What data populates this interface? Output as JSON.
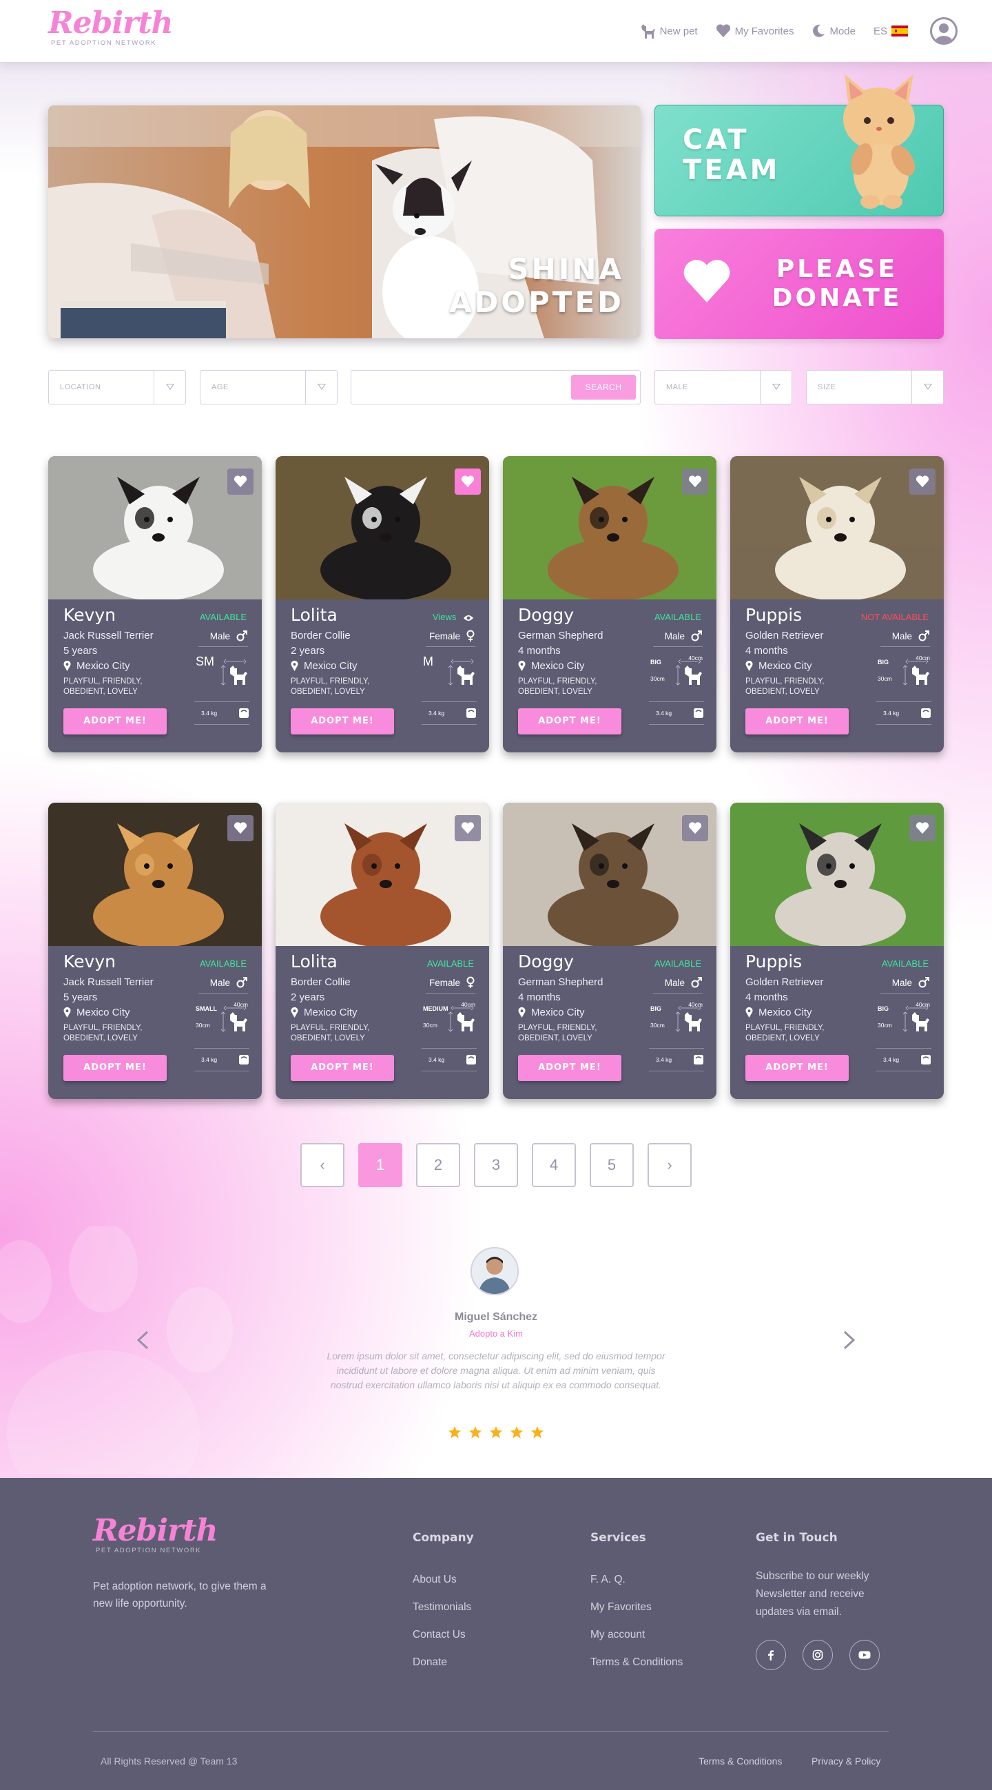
{
  "brand": {
    "name": "Rebirth",
    "tagline": "PET ADOPTION NETWORK",
    "accent": "#f683d5",
    "dark": "#5d5c73"
  },
  "nav": {
    "new_pet": "New pet",
    "favorites": "My Favorites",
    "mode": "Mode",
    "language": "ES"
  },
  "hero": {
    "caption_line1": "SHINA",
    "caption_line2": "ADOPTED"
  },
  "promos": {
    "cat_line1": "CAT",
    "cat_line2": "TEAM",
    "donate_line1": "PLEASE",
    "donate_line2": "DONATE"
  },
  "filters": {
    "location": "LOCATION",
    "age": "AGE",
    "search_placeholder": "",
    "search_button": "SEARCH",
    "sex": "MALE",
    "size": "SIZE"
  },
  "cards": [
    {
      "name": "Kevyn",
      "status": "AVAILABLE",
      "breed": "Jack Russell Terrier",
      "age": "5 years",
      "location": "Mexico City",
      "traits": "PLAYFUL, FRIENDLY, OBEDIENT, LOVELY",
      "gender": "Male",
      "size": "SM",
      "height": "",
      "weight": "3.4 kg",
      "adopt": "ADOPT ME!"
    },
    {
      "name": "Lolita",
      "status": "Views",
      "breed": "Border Collie",
      "age": "2 years",
      "location": "Mexico City",
      "traits": "PLAYFUL, FRIENDLY, OBEDIENT, LOVELY",
      "gender": "Female",
      "size": "M",
      "height": "",
      "weight": "3.4 kg",
      "adopt": "ADOPT ME!"
    },
    {
      "name": "Doggy",
      "status": "AVAILABLE",
      "breed": "German Shepherd",
      "age": "4 months",
      "location": "Mexico City",
      "traits": "PLAYFUL, FRIENDLY, OBEDIENT, LOVELY",
      "gender": "Male",
      "size": "BIG",
      "height": "30cm",
      "width": "40cm",
      "weight": "3.4 kg",
      "adopt": "ADOPT ME!"
    },
    {
      "name": "Puppis",
      "status": "NOT AVAILABLE",
      "breed": "Golden Retriever",
      "age": "4 months",
      "location": "Mexico City",
      "traits": "PLAYFUL, FRIENDLY, OBEDIENT, LOVELY",
      "gender": "Male",
      "size": "BIG",
      "height": "30cm",
      "width": "40cm",
      "weight": "3.4 kg",
      "adopt": "ADOPT ME!"
    },
    {
      "name": "Kevyn",
      "status": "AVAILABLE",
      "breed": "Jack Russell Terrier",
      "age": "5 years",
      "location": "Mexico City",
      "traits": "PLAYFUL, FRIENDLY, OBEDIENT, LOVELY",
      "gender": "Male",
      "size": "SMALL",
      "height": "30cm",
      "width": "40cm",
      "weight": "3.4 kg",
      "adopt": "ADOPT ME!"
    },
    {
      "name": "Lolita",
      "status": "AVAILABLE",
      "breed": "Border Collie",
      "age": "2 years",
      "location": "Mexico City",
      "traits": "PLAYFUL, FRIENDLY, OBEDIENT, LOVELY",
      "gender": "Female",
      "size": "MEDIUM",
      "height": "30cm",
      "width": "40cm",
      "weight": "3.4 kg",
      "adopt": "ADOPT ME!"
    },
    {
      "name": "Doggy",
      "status": "AVAILABLE",
      "breed": "German Shepherd",
      "age": "4 months",
      "location": "Mexico City",
      "traits": "PLAYFUL, FRIENDLY, OBEDIENT, LOVELY",
      "gender": "Male",
      "size": "BIG",
      "height": "30cm",
      "width": "40cm",
      "weight": "3.4 kg",
      "adopt": "ADOPT ME!"
    },
    {
      "name": "Puppis",
      "status": "AVAILABLE",
      "breed": "Golden Retriever",
      "age": "4 months",
      "location": "Mexico City",
      "traits": "PLAYFUL, FRIENDLY, OBEDIENT, LOVELY",
      "gender": "Male",
      "size": "BIG",
      "height": "30cm",
      "width": "40cm",
      "weight": "3.4 kg",
      "adopt": "ADOPT ME!"
    }
  ],
  "pagination": {
    "prev": "‹",
    "pages": [
      "1",
      "2",
      "3",
      "4",
      "5"
    ],
    "current": "1",
    "next": "›"
  },
  "testimonial": {
    "name": "Miguel Sánchez",
    "subtitle": "Adopto a Kim",
    "quote": "Lorem ipsum dolor sit amet, consectetur adipiscing elit, sed do eiusmod tempor incididunt ut labore et dolore magna aliqua. Ut enim ad minim veniam, quis nostrud exercitation ullamco laboris nisi ut aliquip ex ea commodo consequat.",
    "rating": 5
  },
  "footer": {
    "tagline": "Pet adoption network, to give them a new life opportunity.",
    "company_heading": "Company",
    "company_links": [
      "About Us",
      "Testimonials",
      "Contact Us",
      "Donate"
    ],
    "services_heading": "Services",
    "services_links": [
      "F. A. Q.",
      "My Favorites",
      "My account",
      "Terms & Conditions"
    ],
    "contact_heading": "Get in Touch",
    "contact_text": "Subscribe to our weekly Newsletter and receive updates via email.",
    "social": [
      "facebook-icon",
      "instagram-icon",
      "youtube-icon"
    ],
    "copyright": "All Rights Reserved @ Team 13",
    "terms": "Terms & Conditions",
    "privacy": "Privacy & Policy"
  }
}
